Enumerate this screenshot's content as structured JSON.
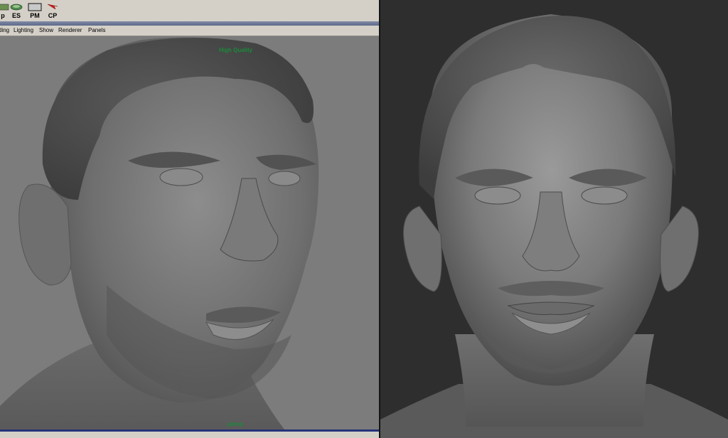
{
  "shelf": {
    "buttons": [
      {
        "label": "p",
        "icon": "partial-tool-icon"
      },
      {
        "label": "ES",
        "icon": "edit-surface-icon"
      },
      {
        "label": "PM",
        "icon": "panel-monitor-icon"
      },
      {
        "label": "CP",
        "icon": "red-arrow-icon"
      }
    ]
  },
  "menubar": {
    "items": [
      "ding",
      "Lighting",
      "Show",
      "Renderer",
      "Panels"
    ]
  },
  "viewport": {
    "hud_quality": "High Quality",
    "camera_label": "persp"
  },
  "colors": {
    "maya_ui": "#d4d0c8",
    "viewport_bg": "#7c7c7c",
    "hud_text": "#1a8a3a",
    "render_bg": "#2e2e2e",
    "selection_bar": "#27327a"
  }
}
